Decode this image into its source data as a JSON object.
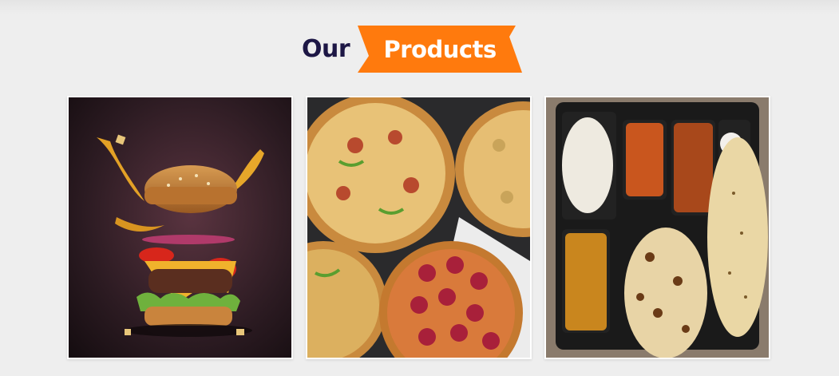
{
  "section": {
    "title_plain": "Our",
    "title_highlight": "Products"
  },
  "colors": {
    "background": "#eeeeee",
    "heading_text": "#1d1745",
    "badge": "#ff7a0d",
    "card_border": "#ffffff"
  },
  "products": [
    {
      "image": "burger-photo"
    },
    {
      "image": "pizza-photo"
    },
    {
      "image": "thali-meal-photo"
    }
  ]
}
